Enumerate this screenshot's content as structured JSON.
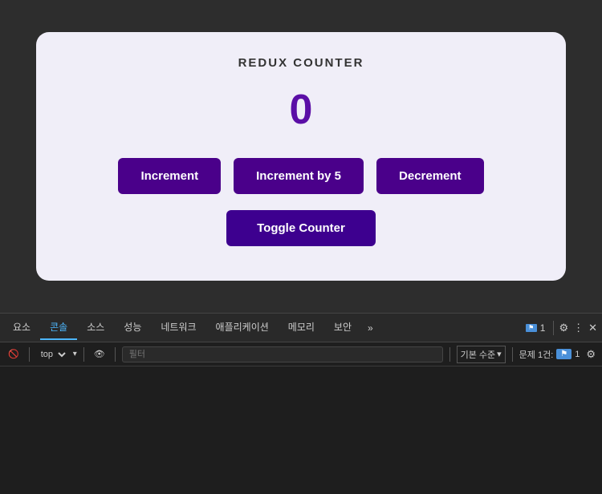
{
  "app": {
    "title": "REDUX COUNTER",
    "counter_value": "0"
  },
  "buttons": {
    "increment": "Increment",
    "increment_by": "Increment by 5",
    "decrement": "Decrement",
    "toggle": "Toggle Counter"
  },
  "devtools": {
    "tabs": [
      {
        "label": "요소",
        "active": false
      },
      {
        "label": "콘솔",
        "active": true
      },
      {
        "label": "소스",
        "active": false
      },
      {
        "label": "성능",
        "active": false
      },
      {
        "label": "네트워크",
        "active": false
      },
      {
        "label": "애플리케이션",
        "active": false
      },
      {
        "label": "메모리",
        "active": false
      },
      {
        "label": "보안",
        "active": false
      }
    ],
    "more_tabs": "»",
    "toolbar": {
      "context": "top",
      "filter_placeholder": "필터",
      "level": "기본 수준",
      "issues_label": "문제 1건:",
      "issues_count": "1"
    }
  },
  "icons": {
    "flag": "⚑",
    "gear": "⚙",
    "ellipsis": "⋮",
    "close": "✕",
    "ban": "🚫",
    "eye": "👁",
    "chevron_down": "▾"
  }
}
